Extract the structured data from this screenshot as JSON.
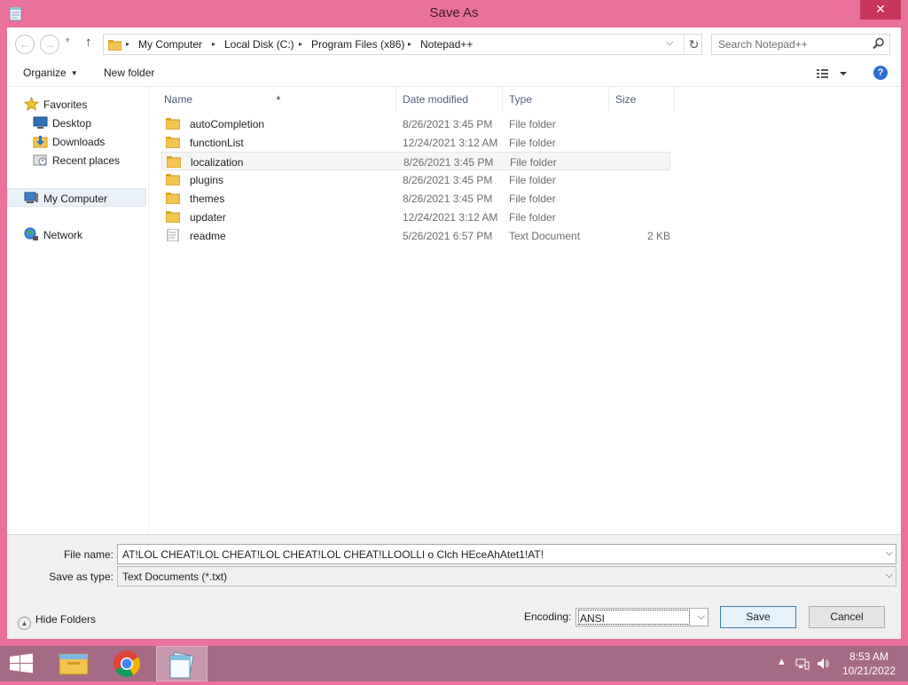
{
  "window": {
    "title": "Save As",
    "close_label": "✕"
  },
  "nav": {
    "back_label": "←",
    "forward_label": "→",
    "recent_label": "▾",
    "up_label": "↑"
  },
  "address": {
    "crumbs": [
      "My Computer",
      "Local Disk (C:)",
      "Program Files (x86)",
      "Notepad++"
    ],
    "separator": "▸",
    "dropdown_label": "⌵",
    "refresh_label": "↻"
  },
  "search": {
    "placeholder": "Search Notepad++"
  },
  "toolbar": {
    "organize_label": "Organize",
    "new_folder_label": "New folder",
    "caret": "▼",
    "help_label": "?"
  },
  "sidebar": {
    "items": [
      {
        "label": "Favorites",
        "icon": "star-icon"
      },
      {
        "label": "Desktop",
        "icon": "desktop-icon"
      },
      {
        "label": "Downloads",
        "icon": "downloads-icon"
      },
      {
        "label": "Recent places",
        "icon": "recent-places-icon"
      },
      {
        "label": "My Computer",
        "icon": "computer-icon",
        "selected": true
      },
      {
        "label": "Network",
        "icon": "network-icon"
      }
    ]
  },
  "columns": {
    "name": "Name",
    "date": "Date modified",
    "type": "Type",
    "size": "Size",
    "sort_indicator": "▲"
  },
  "files": [
    {
      "name": "autoCompletion",
      "date": "8/26/2021 3:45 PM",
      "type": "File folder",
      "size": "",
      "icon": "folder-icon"
    },
    {
      "name": "functionList",
      "date": "12/24/2021 3:12 AM",
      "type": "File folder",
      "size": "",
      "icon": "folder-icon"
    },
    {
      "name": "localization",
      "date": "8/26/2021 3:45 PM",
      "type": "File folder",
      "size": "",
      "icon": "folder-icon"
    },
    {
      "name": "plugins",
      "date": "8/26/2021 3:45 PM",
      "type": "File folder",
      "size": "",
      "icon": "folder-icon"
    },
    {
      "name": "themes",
      "date": "8/26/2021 3:45 PM",
      "type": "File folder",
      "size": "",
      "icon": "folder-icon"
    },
    {
      "name": "updater",
      "date": "12/24/2021 3:12 AM",
      "type": "File folder",
      "size": "",
      "icon": "folder-icon"
    },
    {
      "name": "readme",
      "date": "5/26/2021 6:57 PM",
      "type": "Text Document",
      "size": "2 KB",
      "icon": "text-document-icon"
    }
  ],
  "form": {
    "file_name_label": "File name:",
    "file_name_value": "AT!LOL CHEAT!LOL CHEAT!LOL CHEAT!LOL CHEAT!LLOOLLI o Clch HEceAhAtet1!AT!",
    "save_type_label": "Save as type:",
    "save_type_value": "Text Documents (*.txt)",
    "dropdown_arrow": "⌵",
    "hide_folders_label": "Hide Folders",
    "hide_folders_chevron": "▲",
    "encoding_label": "Encoding:",
    "encoding_value": "ANSI",
    "save_label": "Save",
    "cancel_label": "Cancel"
  },
  "colors": {
    "frame": "#e9719c",
    "taskbar": "#a56a86",
    "close": "#c7365b",
    "selection": "#eaf0f7",
    "header_text": "#4c607a"
  },
  "taskbar": {
    "apps": [
      "file-explorer-icon",
      "chrome-icon",
      "notepad-icon"
    ],
    "tray_arrow": "▲",
    "time": "8:53 AM",
    "date": "10/21/2022"
  }
}
